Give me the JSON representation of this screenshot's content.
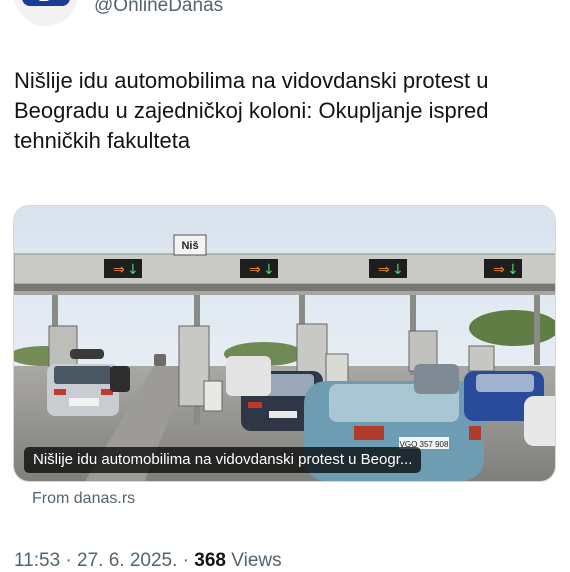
{
  "header": {
    "handle": "@OnlineDanas",
    "avatar_text": "D"
  },
  "tweet": {
    "text": "Nišlije idu automobilima na vidovdanski protest u Beogradu u zajedničkoj koloni: Okupljanje ispred tehničkih fakulteta"
  },
  "card": {
    "caption": "Nišlije idu automobilima na vidovdanski protest u Beogr...",
    "source": "From danas.rs",
    "sign_text": "Niš",
    "plate_text": "VGO 357 908"
  },
  "meta": {
    "time": "11:53",
    "separator1": " · ",
    "date": "27. 6. 2025.",
    "separator2": " · ",
    "views_count": "368",
    "views_label": " Views"
  },
  "colors": {
    "brand": "#1b3c96",
    "muted": "#536471",
    "text": "#0f1419"
  }
}
